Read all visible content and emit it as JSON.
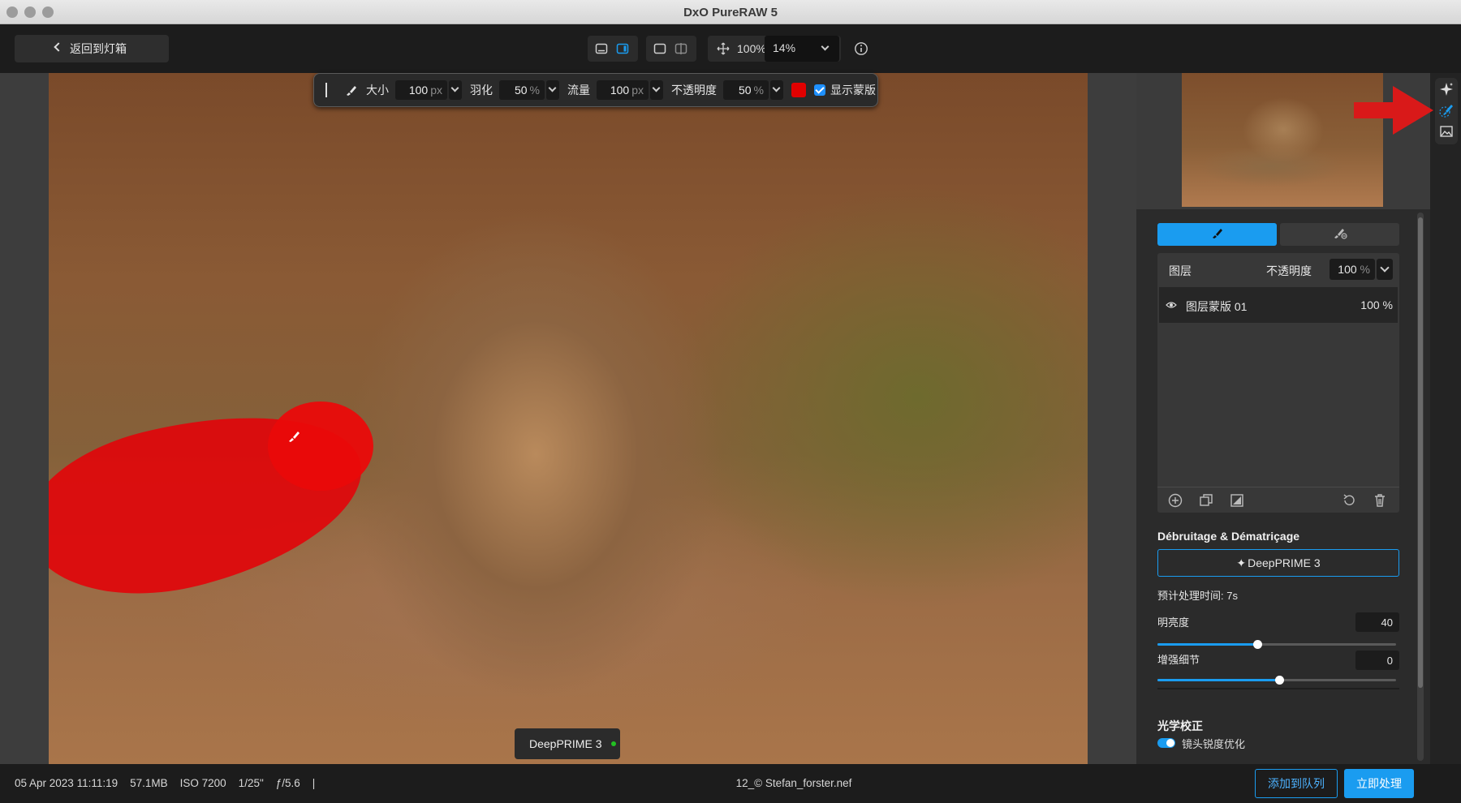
{
  "window": {
    "title": "DxO PureRAW 5"
  },
  "topbar": {
    "back_label": "返回到灯箱",
    "zoom_fit": "100%",
    "zoom_select": "14%"
  },
  "brush_toolbar": {
    "size_label": "大小",
    "size_value": "100",
    "size_unit": "px",
    "feather_label": "羽化",
    "feather_value": "50",
    "feather_unit": "%",
    "flow_label": "流量",
    "flow_value": "100",
    "flow_unit": "px",
    "opacity_label": "不透明度",
    "opacity_value": "50",
    "opacity_unit": "%",
    "mask_color": "#e10000",
    "show_mask_label": "显示蒙版",
    "show_mask_checked": true
  },
  "preset_badge": {
    "label": "DeepPRIME 3",
    "status_color": "#22c022"
  },
  "layers": {
    "header_label": "图层",
    "opacity_label": "不透明度",
    "opacity_value": "100",
    "opacity_unit": "%",
    "items": [
      {
        "name": "图层蒙版 01",
        "opacity": "100 %"
      }
    ]
  },
  "denoise": {
    "section_title": "Débruitage & Dématriçage",
    "preset_button": "DeepPRIME 3",
    "estimate": "预计处理时间: 7s",
    "sliders": [
      {
        "label": "明亮度",
        "value": "40",
        "fraction": 0.42
      },
      {
        "label": "增强细节",
        "value": "0",
        "fraction": 0.51
      }
    ]
  },
  "optics": {
    "section_title": "光学校正",
    "toggle_label": "镜头锐度优化",
    "toggle_on": true
  },
  "statusbar": {
    "meta": "05 Apr 2023 11:11:19    57.1MB    ISO 7200    1/25\"    ƒ/5.6    |",
    "filename": "12_© Stefan_forster.nef",
    "queue_button": "添加到队列",
    "process_button": "立即处理"
  },
  "accent_color": "#1a9cf0"
}
